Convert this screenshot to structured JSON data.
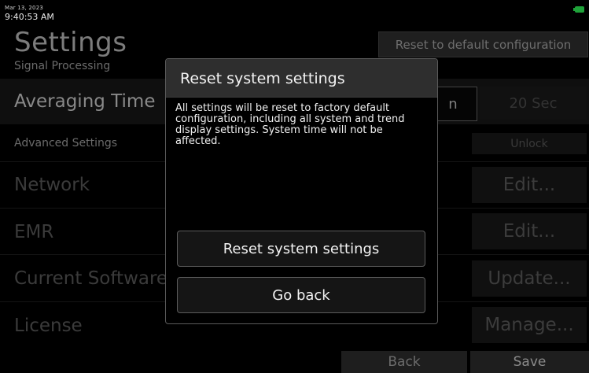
{
  "status": {
    "date": "Mar 13, 2023",
    "time": "9:40:53 AM",
    "battery_icon": "battery-icon",
    "battery_color": "#1fa33a"
  },
  "page": {
    "title": "Settings",
    "reset_default_label": "Reset to default configuration",
    "section_signal": "Signal Processing",
    "averaging_label": "Averaging Time",
    "averaging_option_partial": "n",
    "averaging_option_2": "20 Sec",
    "section_advanced": "Advanced Settings",
    "unlock_label": "Unlock",
    "rows": [
      {
        "label": "Network",
        "button": "Edit..."
      },
      {
        "label": "EMR",
        "button": "Edit..."
      },
      {
        "label": "Current Software",
        "button": "Update..."
      },
      {
        "label": "License",
        "button": "Manage..."
      }
    ]
  },
  "footer": {
    "back_label": "Back",
    "save_label": "Save"
  },
  "modal": {
    "title": "Reset system settings",
    "body": "All settings will be reset to factory default configuration, including all system and trend display settings. System time will not be affected.",
    "confirm_label": "Reset system settings",
    "cancel_label": "Go back"
  }
}
